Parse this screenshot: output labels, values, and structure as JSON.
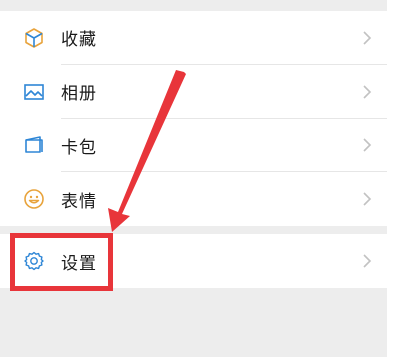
{
  "menu": {
    "items": [
      {
        "label": "收藏",
        "icon": "cube-icon"
      },
      {
        "label": "相册",
        "icon": "photo-icon"
      },
      {
        "label": "卡包",
        "icon": "card-wallet-icon"
      },
      {
        "label": "表情",
        "icon": "smiley-icon"
      }
    ],
    "settings": {
      "label": "设置",
      "icon": "gear-icon"
    }
  },
  "colors": {
    "accent_icon": "#2e86d6",
    "yellow_icon": "#e8a33c",
    "highlight": "#e8353a",
    "chevron": "#c2c2c2",
    "background_gap": "#ededed"
  }
}
